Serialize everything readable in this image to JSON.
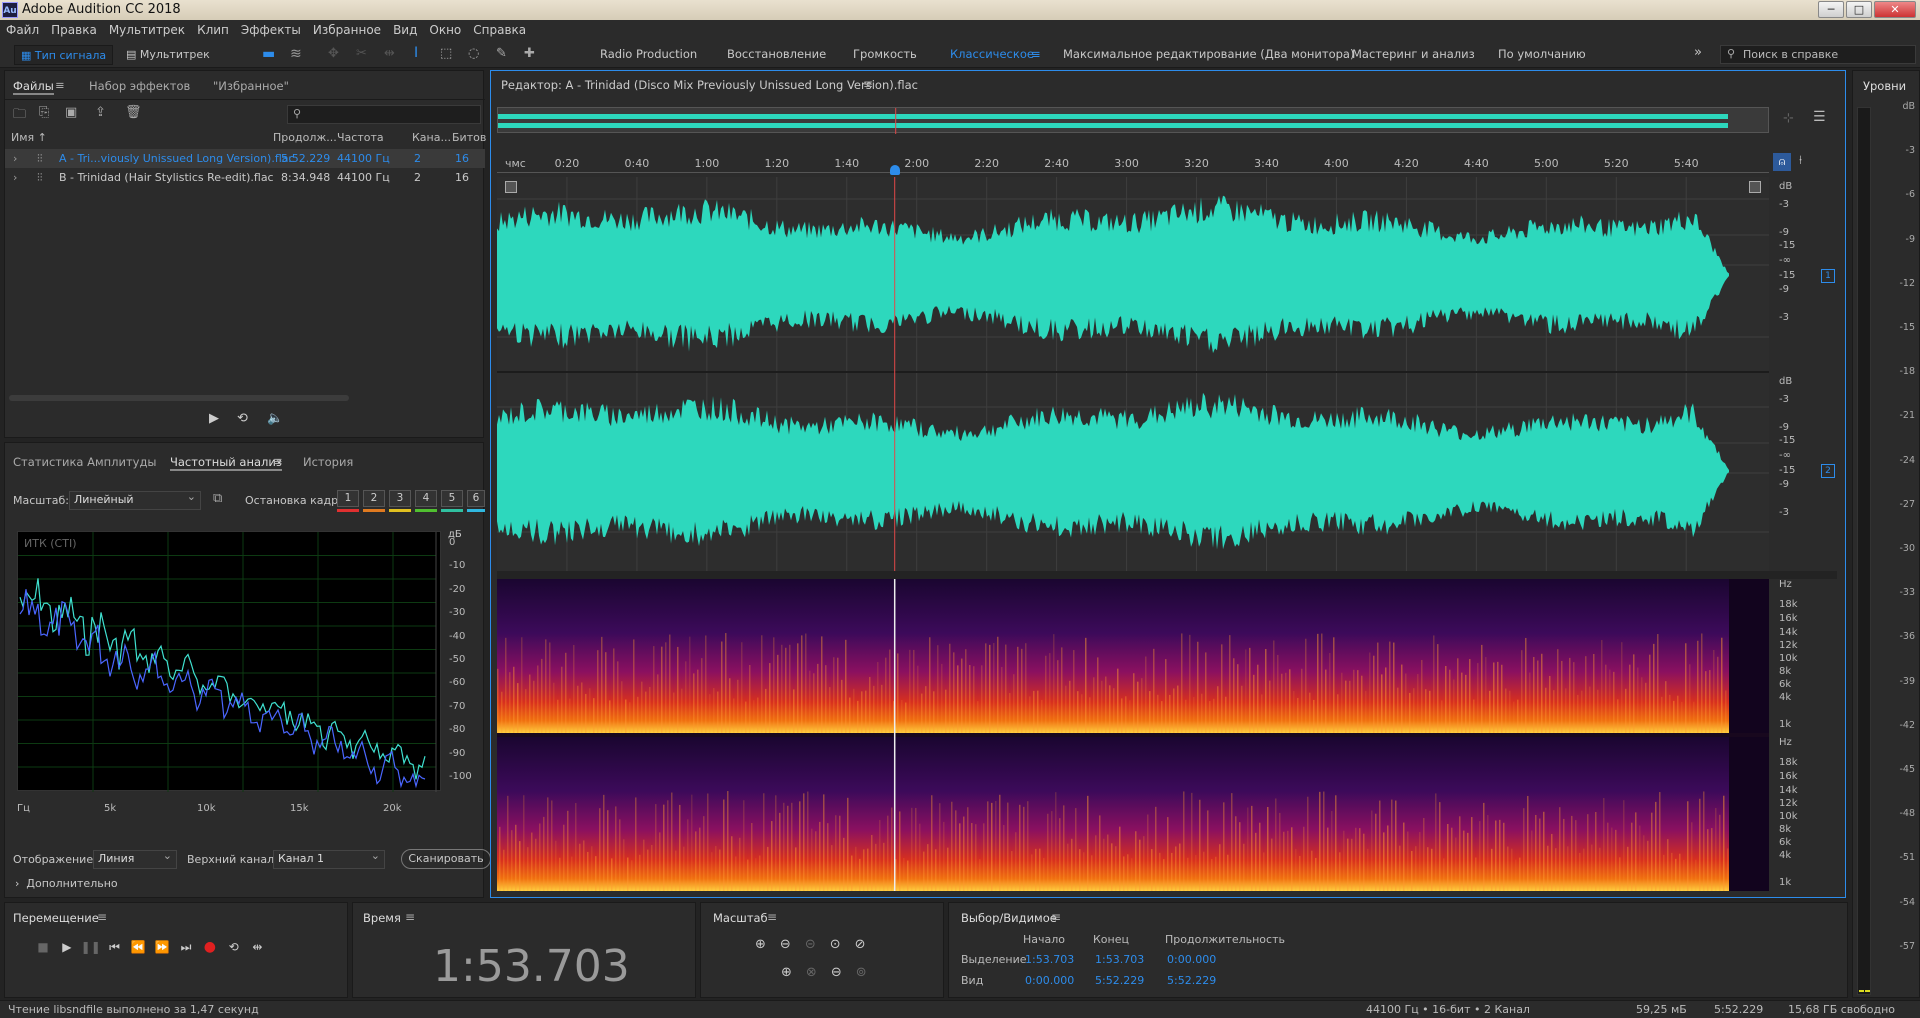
{
  "titlebar": {
    "logo": "Au",
    "title": "Adobe Audition CC 2018",
    "min": "─",
    "max": "□",
    "close": "✕"
  },
  "menu": [
    "Файл",
    "Правка",
    "Мультитрек",
    "Клип",
    "Эффекты",
    "Избранное",
    "Вид",
    "Окно",
    "Справка"
  ],
  "toolbar": {
    "waveform_mode": "Тип сигнала",
    "multitrack_mode": "Мультитрек",
    "workspaces": [
      "Radio Production",
      "Восстановление",
      "Громкость",
      "Классическое",
      "Максимальное редактирование (Два монитора)",
      "Мастеринг и анализ",
      "По умолчанию"
    ],
    "active_workspace": "Классическое",
    "search_placeholder": "Поиск в справке"
  },
  "files_panel": {
    "tabs": [
      "Файлы",
      "Набор эффектов",
      "\"Избранное\""
    ],
    "search_value": "",
    "columns": [
      "Имя",
      "Продолж...",
      "Частота",
      "Кана...",
      "Битов"
    ],
    "rows": [
      {
        "name": "A - Tri...viously Unissued Long Version).flac",
        "duration": "5:52.229",
        "rate": "44100 Гц",
        "channels": "2",
        "bits": "16",
        "selected": true
      },
      {
        "name": "B - Trinidad (Hair Stylistics Re-edit).flac",
        "duration": "8:34.948",
        "rate": "44100 Гц",
        "channels": "2",
        "bits": "16",
        "selected": false
      }
    ]
  },
  "freq_panel": {
    "tabs": [
      "Статистика Амплитуды",
      "Частотный анализ",
      "История"
    ],
    "scale_label": "Масштаб:",
    "scale_value": "Линейный",
    "freeze_label": "Остановка кадра:",
    "freeze_buttons": [
      "1",
      "2",
      "3",
      "4",
      "5",
      "6"
    ],
    "freeze_colors": [
      "#e03030",
      "#e07a20",
      "#e0c020",
      "#50c030",
      "#30c0a0",
      "#30b8e0"
    ],
    "plot_label": "ИТК (CTI)",
    "db_unit": "дБ",
    "db_ticks": [
      "0",
      "-10",
      "-20",
      "-30",
      "-40",
      "-50",
      "-60",
      "-70",
      "-80",
      "-90",
      "-100"
    ],
    "hz_ticks": [
      "Гц",
      "5k",
      "10k",
      "15k",
      "20k"
    ],
    "display_label": "Отображение:",
    "display_value": "Линия",
    "channel_label": "Верхний канал:",
    "channel_value": "Канал 1",
    "scan_button": "Сканировать",
    "advanced": "Дополнительно"
  },
  "editor": {
    "title": "Редактор: A - Trinidad (Disco Mix Previously Unissued Long Version).flac",
    "ruler": [
      "чмс",
      "0:20",
      "0:40",
      "1:00",
      "1:20",
      "1:40",
      "2:00",
      "2:20",
      "2:40",
      "3:00",
      "3:20",
      "3:40",
      "4:00",
      "4:20",
      "4:40",
      "5:00",
      "5:20",
      "5:40"
    ],
    "db_ticks": [
      "dB",
      "-3",
      "-9",
      "-15",
      "-∞",
      "-15",
      "-9",
      "-3"
    ],
    "channel_1": "1",
    "channel_2": "2",
    "hz_ticks": [
      "Hz",
      "18k",
      "16k",
      "14k",
      "12k",
      "10k",
      "8k",
      "6k",
      "4k",
      "1k"
    ],
    "playhead": 113.703,
    "duration": 352.229
  },
  "levels": {
    "title": "Уровни",
    "ticks": [
      "dB",
      "-3",
      "-6",
      "-9",
      "-12",
      "-15",
      "-18",
      "-21",
      "-24",
      "-27",
      "-30",
      "-33",
      "-36",
      "-39",
      "-42",
      "-45",
      "-48",
      "-51",
      "-54",
      "-57"
    ]
  },
  "transport": {
    "title": "Перемещение"
  },
  "time": {
    "title": "Время",
    "value": "1:53.703"
  },
  "zoom": {
    "title": "Масштаб"
  },
  "selection": {
    "title": "Выбор/Видимое",
    "headers": [
      "Начало",
      "Конец",
      "Продолжительность"
    ],
    "rows": [
      {
        "label": "Выделение",
        "start": "1:53.703",
        "end": "1:53.703",
        "duration": "0:00.000"
      },
      {
        "label": "Вид",
        "start": "0:00.000",
        "end": "5:52.229",
        "duration": "5:52.229"
      }
    ]
  },
  "status": {
    "message": "Чтение libsndfile выполнено за 1,47 секунд",
    "format": "44100 Гц • 16-бит • 2 Канал",
    "size": "59,25 мБ",
    "duration": "5:52.229",
    "free": "15,68 ГБ свободно"
  }
}
